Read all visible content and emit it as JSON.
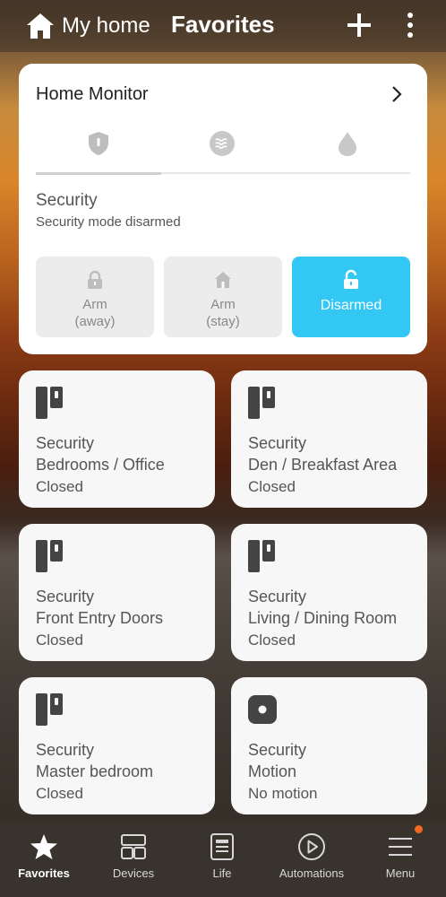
{
  "header": {
    "home_label": "My home",
    "title": "Favorites",
    "icons": [
      "home-icon",
      "plus-icon",
      "more-vertical-icon"
    ]
  },
  "monitor": {
    "title": "Home Monitor",
    "mode_tabs": [
      "shield-icon",
      "heat-icon",
      "water-drop-icon"
    ],
    "section_label": "Security",
    "section_status": "Security mode disarmed",
    "buttons": [
      {
        "label": "Arm\n(away)",
        "icon": "lock-icon",
        "active": false
      },
      {
        "label": "Arm\n(stay)",
        "icon": "house-icon",
        "active": false
      },
      {
        "label": "Disarmed",
        "icon": "unlock-icon",
        "active": true
      }
    ],
    "buttons_line": {
      "arm_away_1": "Arm",
      "arm_away_2": "(away)",
      "arm_stay_1": "Arm",
      "arm_stay_2": "(stay)",
      "disarmed": "Disarmed"
    },
    "accent_color": "#33c8f4"
  },
  "cards": [
    {
      "type": "Security",
      "name": "Bedrooms / Office",
      "status": "Closed",
      "icon": "door-sensor-icon"
    },
    {
      "type": "Security",
      "name": "Den / Breakfast Area",
      "status": "Closed",
      "icon": "door-sensor-icon"
    },
    {
      "type": "Security",
      "name": "Front Entry Doors",
      "status": "Closed",
      "icon": "door-sensor-icon"
    },
    {
      "type": "Security",
      "name": "Living / Dining Room",
      "status": "Closed",
      "icon": "door-sensor-icon"
    },
    {
      "type": "Security",
      "name": "Master bedroom",
      "status": "Closed",
      "icon": "door-sensor-icon"
    },
    {
      "type": "Security",
      "name": "Motion",
      "status": "No motion",
      "icon": "motion-sensor-icon"
    }
  ],
  "nav": [
    {
      "label": "Favorites",
      "icon": "star-icon",
      "active": true
    },
    {
      "label": "Devices",
      "icon": "devices-icon",
      "active": false
    },
    {
      "label": "Life",
      "icon": "life-icon",
      "active": false
    },
    {
      "label": "Automations",
      "icon": "play-circle-icon",
      "active": false
    },
    {
      "label": "Menu",
      "icon": "menu-icon",
      "active": false
    }
  ],
  "badge_color": "#f26a21"
}
